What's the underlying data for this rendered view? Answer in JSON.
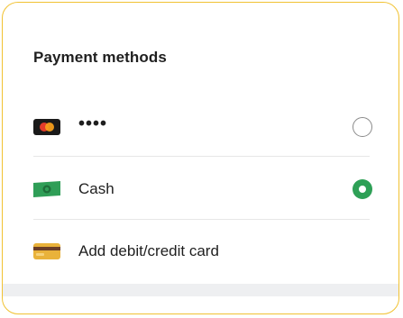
{
  "section": {
    "title": "Payment methods"
  },
  "methods": [
    {
      "label": "••••",
      "icon": "mastercard-icon",
      "selected": false
    },
    {
      "label": "Cash",
      "icon": "cash-icon",
      "selected": true
    },
    {
      "label": "Add debit/credit card",
      "icon": "credit-card-icon"
    }
  ],
  "colors": {
    "border_accent": "#f1c232",
    "selected_green": "#2ea056",
    "cash_green": "#2f9e57",
    "card_gold": "#e9b23a",
    "card_brown": "#6b3e26"
  }
}
